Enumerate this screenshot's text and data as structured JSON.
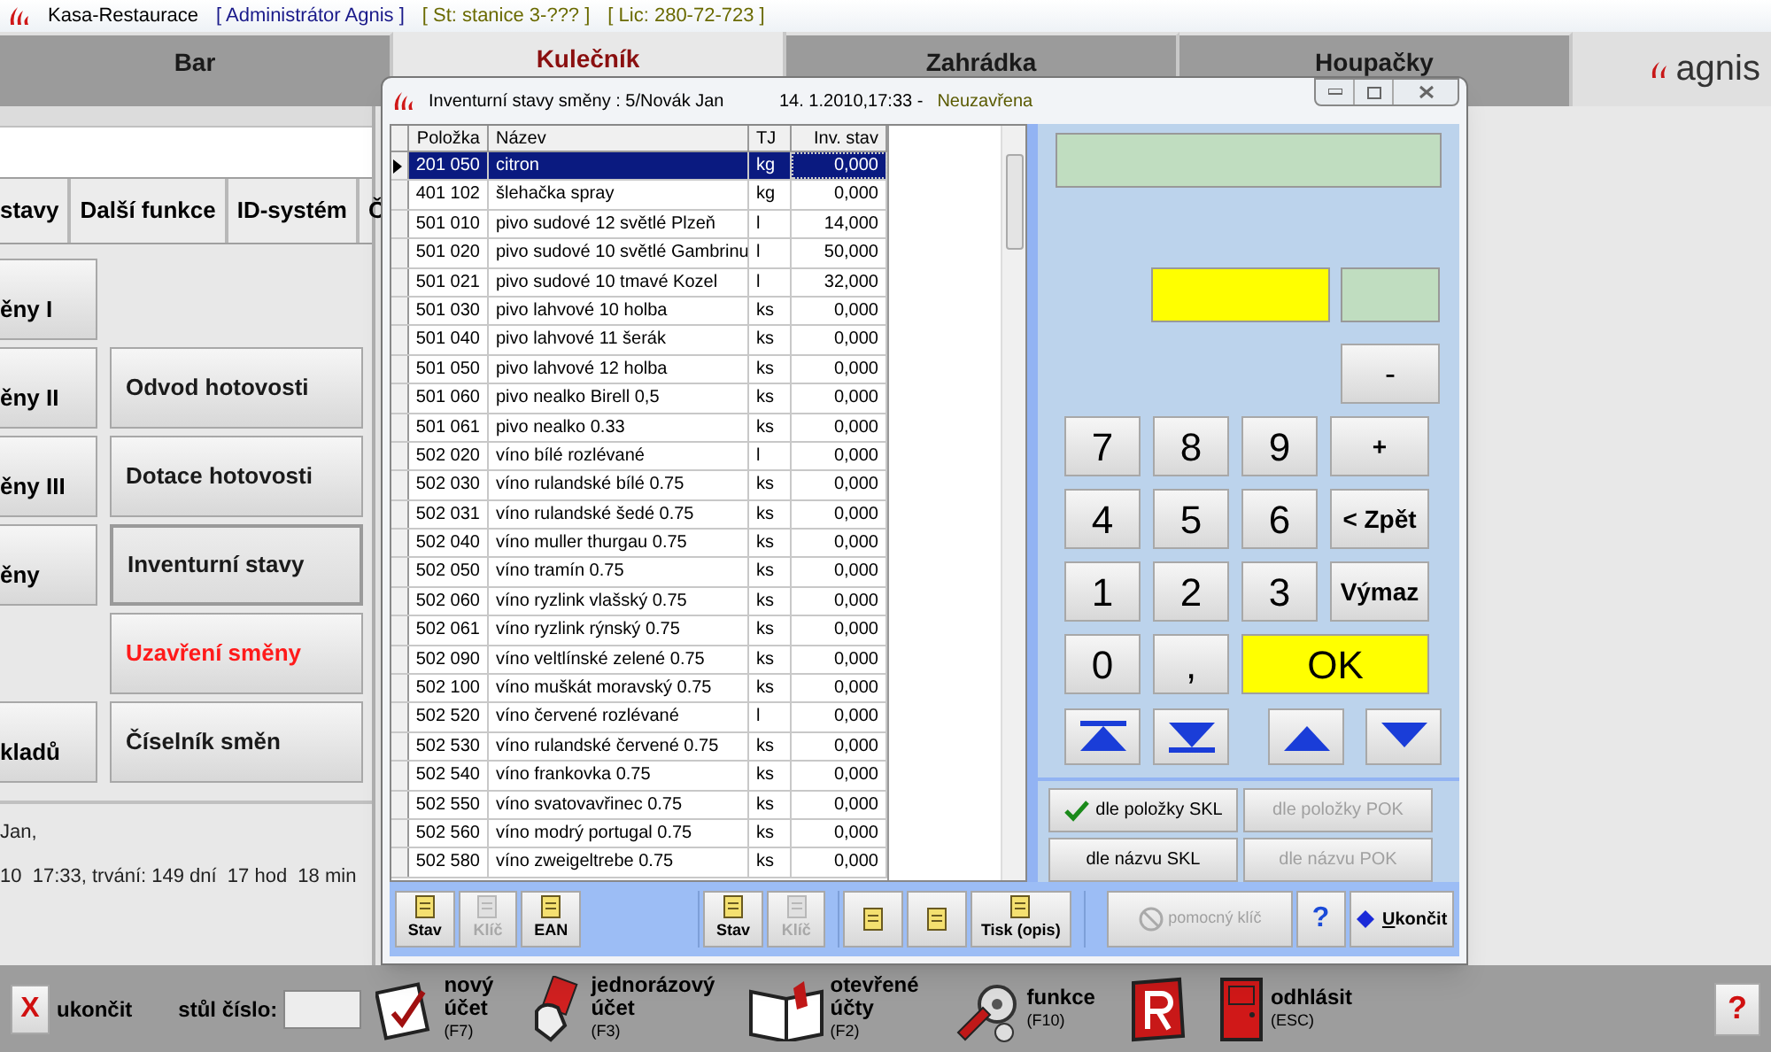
{
  "window": {
    "title": "Kasa-Restaurace",
    "user": "[ Administrátor Agnis ]",
    "station": "[ St: stanice 3-??? ]",
    "license": "[ Lic: 280-72-723 ]"
  },
  "tabs": [
    {
      "label": "Bar",
      "selected": false
    },
    {
      "label": "Kulečník",
      "selected": true
    },
    {
      "label": "Zahrádka",
      "selected": false
    },
    {
      "label": "Houpačky",
      "selected": false
    }
  ],
  "logo": "agnis",
  "subtabs": [
    "stavy",
    "Další funkce",
    "ID-systém",
    "Č"
  ],
  "function_rows": [
    {
      "left": "ěny I"
    },
    {
      "left": "ěny II",
      "right": {
        "label": "Odvod hotovosti",
        "kind": "normal"
      }
    },
    {
      "left": "ěny III",
      "right": {
        "label": "Dotace hotovosti",
        "kind": "normal"
      }
    },
    {
      "left": "ěny",
      "right": {
        "label": "Inventurní stavy",
        "kind": "pressed"
      }
    },
    {
      "right": {
        "label": "Uzavření směny",
        "kind": "warning"
      }
    },
    {
      "left": "kladů",
      "right": {
        "label": "Číselník směn",
        "kind": "normal"
      }
    }
  ],
  "shift_info": [
    "Jan,",
    "10  17:33, trvání: 149 dní  17 hod  18 min"
  ],
  "dialog": {
    "title": "Inventurní stavy směny :  5/Novák Jan",
    "date": "14. 1.2010,17:33 -",
    "status": "Neuzavřena",
    "table": {
      "columns": [
        "Položka",
        "Název",
        "TJ",
        "Inv. stav"
      ],
      "rows": [
        {
          "cells": [
            "201 050",
            "citron",
            "kg",
            "0,000"
          ],
          "selected": true
        },
        {
          "cells": [
            "401 102",
            "šlehačka spray",
            "kg",
            "0,000"
          ],
          "selected": false
        },
        {
          "cells": [
            "501 010",
            "pivo sudové 12 světlé Plzeň",
            "l",
            "14,000"
          ],
          "selected": false
        },
        {
          "cells": [
            "501 020",
            "pivo sudové 10 světlé Gambrinu",
            "l",
            "50,000"
          ],
          "selected": false
        },
        {
          "cells": [
            "501 021",
            "pivo sudové 10 tmavé Kozel",
            "l",
            "32,000"
          ],
          "selected": false
        },
        {
          "cells": [
            "501 030",
            "pivo lahvové 10 holba",
            "ks",
            "0,000"
          ],
          "selected": false
        },
        {
          "cells": [
            "501 040",
            "pivo lahvové 11 šerák",
            "ks",
            "0,000"
          ],
          "selected": false
        },
        {
          "cells": [
            "501 050",
            "pivo lahvové 12 holba",
            "ks",
            "0,000"
          ],
          "selected": false
        },
        {
          "cells": [
            "501 060",
            "pivo nealko Birell 0,5",
            "ks",
            "0,000"
          ],
          "selected": false
        },
        {
          "cells": [
            "501 061",
            "pivo nealko 0.33",
            "ks",
            "0,000"
          ],
          "selected": false
        },
        {
          "cells": [
            "502 020",
            "víno bílé rozlévané",
            "l",
            "0,000"
          ],
          "selected": false
        },
        {
          "cells": [
            "502 030",
            "víno rulandské bílé 0.75",
            "ks",
            "0,000"
          ],
          "selected": false
        },
        {
          "cells": [
            "502 031",
            "víno rulandské šedé 0.75",
            "ks",
            "0,000"
          ],
          "selected": false
        },
        {
          "cells": [
            "502 040",
            "víno muller thurgau 0.75",
            "ks",
            "0,000"
          ],
          "selected": false
        },
        {
          "cells": [
            "502 050",
            "víno tramín 0.75",
            "ks",
            "0,000"
          ],
          "selected": false
        },
        {
          "cells": [
            "502 060",
            "víno ryzlink vlašský 0.75",
            "ks",
            "0,000"
          ],
          "selected": false
        },
        {
          "cells": [
            "502 061",
            "víno ryzlink rýnský 0.75",
            "ks",
            "0,000"
          ],
          "selected": false
        },
        {
          "cells": [
            "502 090",
            "víno veltlínské zelené 0.75",
            "ks",
            "0,000"
          ],
          "selected": false
        },
        {
          "cells": [
            "502 100",
            "víno muškát moravský 0.75",
            "ks",
            "0,000"
          ],
          "selected": false
        },
        {
          "cells": [
            "502 520",
            "víno červené rozlévané",
            "l",
            "0,000"
          ],
          "selected": false
        },
        {
          "cells": [
            "502 530",
            "víno rulandské červené 0.75",
            "ks",
            "0,000"
          ],
          "selected": false
        },
        {
          "cells": [
            "502 540",
            "víno frankovka 0.75",
            "ks",
            "0,000"
          ],
          "selected": false
        },
        {
          "cells": [
            "502 550",
            "víno svatovavřinec 0.75",
            "ks",
            "0,000"
          ],
          "selected": false
        },
        {
          "cells": [
            "502 560",
            "víno modrý portugal 0.75",
            "ks",
            "0,000"
          ],
          "selected": false
        },
        {
          "cells": [
            "502 580",
            "víno zweigeltrebe 0.75",
            "ks",
            "0,000"
          ],
          "selected": false
        }
      ]
    },
    "minus_key": "-",
    "keys": [
      {
        "label": "7",
        "kind": "digit"
      },
      {
        "label": "8",
        "kind": "digit"
      },
      {
        "label": "9",
        "kind": "digit"
      },
      {
        "label": "+",
        "kind": "action"
      },
      {
        "label": "4",
        "kind": "digit"
      },
      {
        "label": "5",
        "kind": "digit"
      },
      {
        "label": "6",
        "kind": "digit"
      },
      {
        "label": "< Zpět",
        "kind": "action"
      },
      {
        "label": "1",
        "kind": "digit"
      },
      {
        "label": "2",
        "kind": "digit"
      },
      {
        "label": "3",
        "kind": "digit"
      },
      {
        "label": "Výmaz",
        "kind": "action"
      },
      {
        "label": "0",
        "kind": "digit"
      },
      {
        "label": ",",
        "kind": "digit"
      },
      {
        "label": "OK",
        "kind": "ok"
      }
    ],
    "sort_buttons": [
      {
        "label": "dle položky SKL",
        "checked": true,
        "disabled": false
      },
      {
        "label": "dle položky POK",
        "checked": false,
        "disabled": true
      },
      {
        "label": "dle názvu SKL",
        "checked": false,
        "disabled": false
      },
      {
        "label": "dle názvu POK",
        "checked": false,
        "disabled": true
      }
    ],
    "toolbar_groups": [
      [
        {
          "label": "Stav",
          "disabled": false
        },
        {
          "label": "Klíč",
          "disabled": true
        },
        {
          "label": "EAN",
          "disabled": false
        }
      ],
      [
        {
          "label": "Stav",
          "disabled": false
        },
        {
          "label": "Klíč",
          "disabled": true
        }
      ],
      [
        {
          "disabled": false
        },
        {
          "disabled": false
        },
        {
          "label": "Tisk (opis)",
          "disabled": false
        }
      ]
    ],
    "helper_key": {
      "label": "pomocný klíč",
      "disabled": true
    },
    "help_button": "?",
    "close_button": {
      "hotkey": "U",
      "label": "končit"
    }
  },
  "bottom_bar": {
    "exit_key": "X",
    "exit_label": "ukončit",
    "table_label": "stůl číslo:",
    "actions": [
      {
        "kind": "new",
        "label": "nový účet",
        "shortcut": "(F7)"
      },
      {
        "kind": "single",
        "label": "jednorázový účet",
        "shortcut": "(F3)"
      },
      {
        "kind": "open",
        "label": "otevřené účty",
        "shortcut": "(F2)"
      },
      {
        "kind": "functions",
        "label": "funkce",
        "shortcut": "(F10)"
      },
      {
        "kind": "report"
      },
      {
        "kind": "logout",
        "label": "odhlásit",
        "shortcut": "(ESC)"
      }
    ],
    "help_key": "?"
  }
}
